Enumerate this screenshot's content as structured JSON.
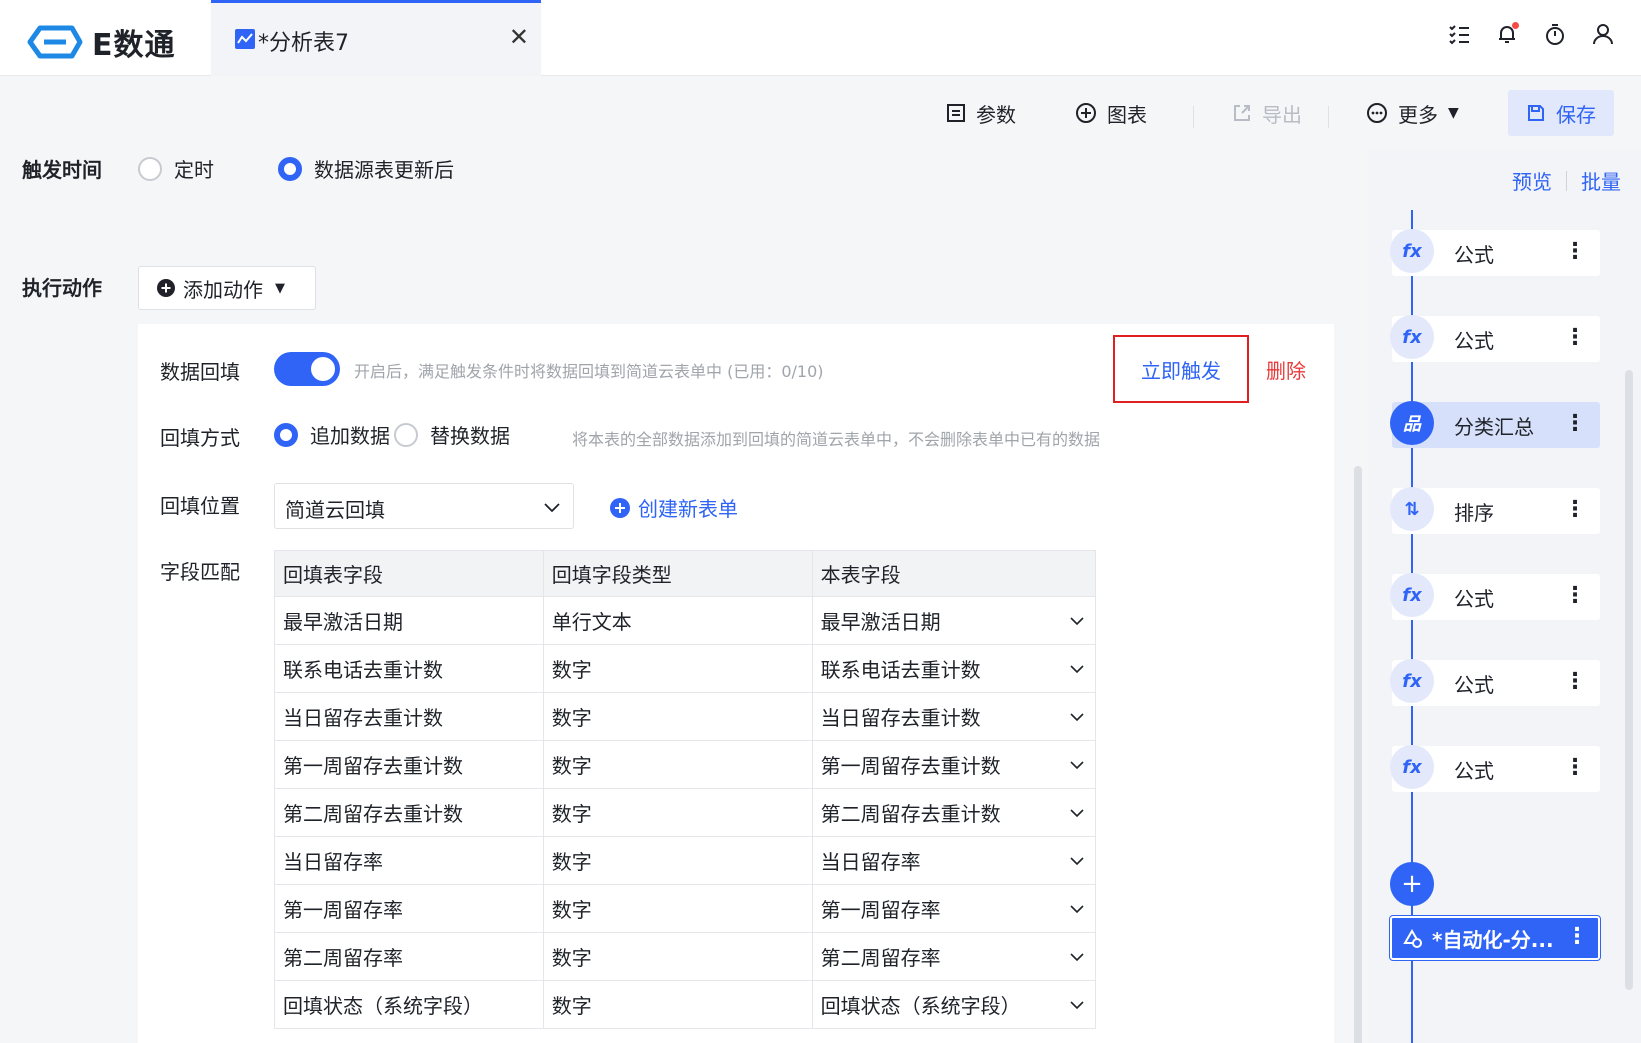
{
  "app": {
    "name": "E数通",
    "accent": "#2f64f6",
    "danger": "#e83a3a"
  },
  "tab": {
    "title": "*分析表7",
    "close": "✕"
  },
  "top_icons": [
    "list-check-icon",
    "bell-icon",
    "stopwatch-icon",
    "user-icon"
  ],
  "toolbar": {
    "params_label": "参数",
    "chart_label": "图表",
    "export_label": "导出",
    "more_label": "更多",
    "save_label": "保存"
  },
  "trigger": {
    "label": "触发时间",
    "options": [
      "定时",
      "数据源表更新后"
    ],
    "selected": "数据源表更新后"
  },
  "action": {
    "label": "执行动作",
    "add_label": "添加动作"
  },
  "backfill": {
    "label": "数据回填",
    "enabled": true,
    "hint": "开启后，满足触发条件时将数据回填到简道云表单中 (已用：0/10)",
    "trigger_now": "立即触发",
    "delete": "删除",
    "mode_label": "回填方式",
    "modes": [
      "追加数据",
      "替换数据"
    ],
    "mode_selected": "追加数据",
    "mode_hint": "将本表的全部数据添加到回填的简道云表单中，不会删除表单中已有的数据",
    "location_label": "回填位置",
    "location_value": "简道云回填",
    "create_form": "创建新表单",
    "match_label": "字段匹配",
    "columns": [
      "回填表字段",
      "回填字段类型",
      "本表字段"
    ],
    "rows": [
      [
        "最早激活日期",
        "单行文本",
        "最早激活日期"
      ],
      [
        "联系电话去重计数",
        "数字",
        "联系电话去重计数"
      ],
      [
        "当日留存去重计数",
        "数字",
        "当日留存去重计数"
      ],
      [
        "第一周留存去重计数",
        "数字",
        "第一周留存去重计数"
      ],
      [
        "第二周留存去重计数",
        "数字",
        "第二周留存去重计数"
      ],
      [
        "当日留存率",
        "数字",
        "当日留存率"
      ],
      [
        "第一周留存率",
        "数字",
        "第一周留存率"
      ],
      [
        "第二周留存率",
        "数字",
        "第二周留存率"
      ],
      [
        "回填状态（系统字段）",
        "数字",
        "回填状态（系统字段）"
      ]
    ]
  },
  "sidebar": {
    "preview": "预览",
    "batch": "批量",
    "nodes": [
      {
        "label": "公式",
        "icon": "fx-icon",
        "active": false
      },
      {
        "label": "公式",
        "icon": "fx-icon",
        "active": false
      },
      {
        "label": "分类汇总",
        "icon": "hierarchy-icon",
        "active": true
      },
      {
        "label": "排序",
        "icon": "sort-icon",
        "active": false
      },
      {
        "label": "公式",
        "icon": "fx-icon",
        "active": false
      },
      {
        "label": "公式",
        "icon": "fx-icon",
        "active": false
      },
      {
        "label": "公式",
        "icon": "fx-icon",
        "active": false
      }
    ],
    "add": "+",
    "automation": "*自动化-分..."
  }
}
